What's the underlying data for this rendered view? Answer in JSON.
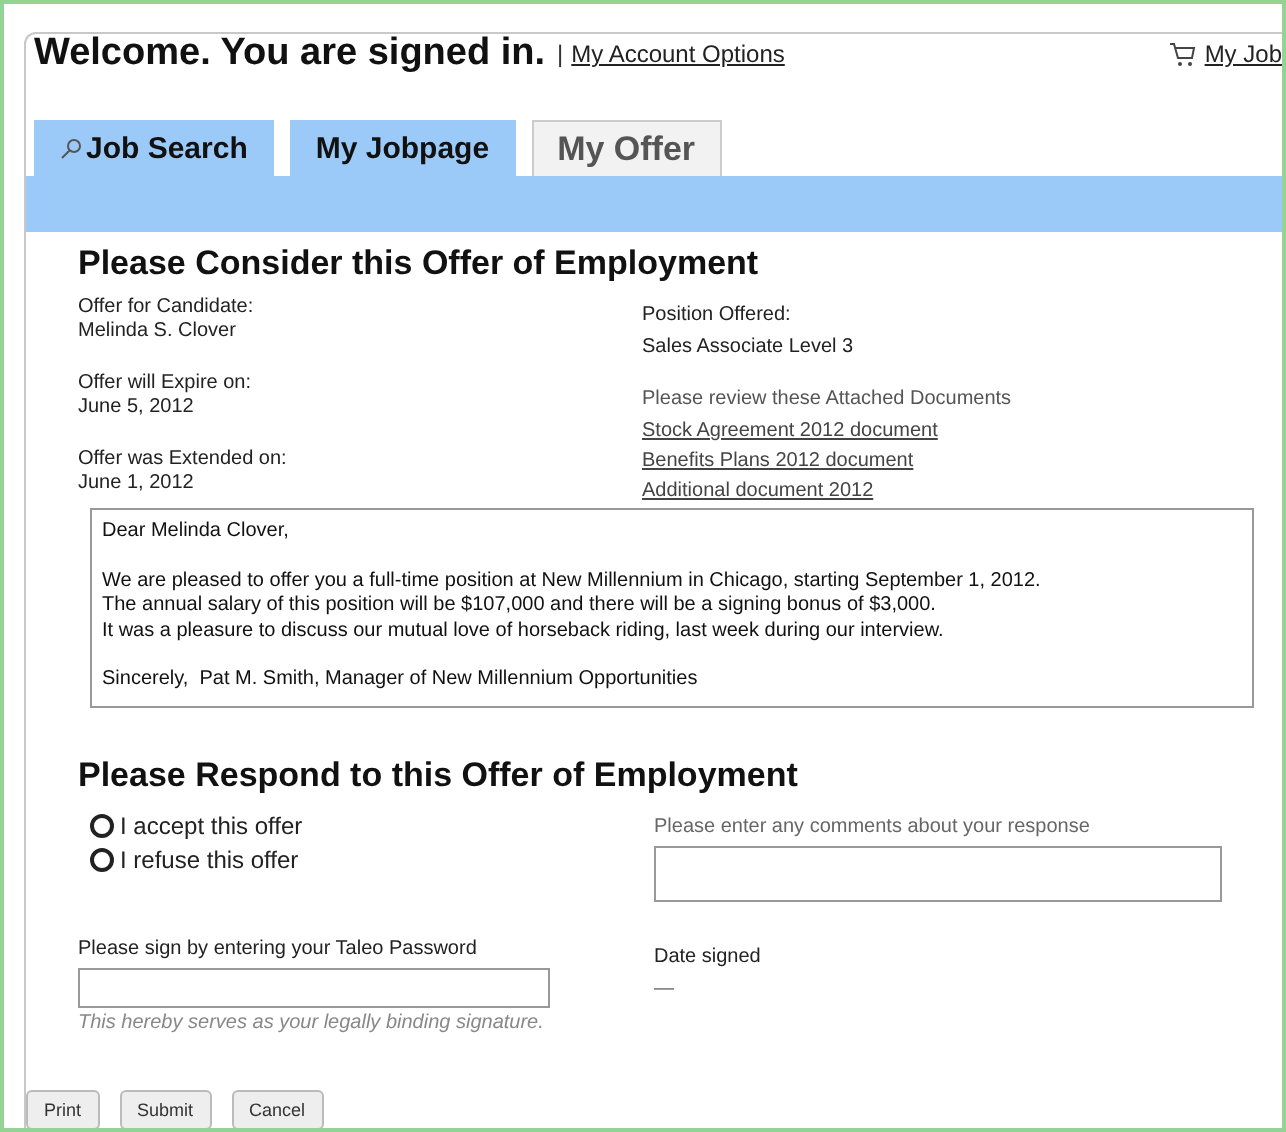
{
  "header": {
    "title": "Welcome. You are signed in.",
    "separator": "|",
    "account_link": "My Account Options",
    "cart_link": "My Job"
  },
  "tabs": [
    {
      "label": "Job Search",
      "selected": false
    },
    {
      "label": "My Jobpage",
      "selected": false
    },
    {
      "label": "My Offer",
      "selected": true
    }
  ],
  "offer": {
    "heading": "Please Consider this Offer of Employment",
    "left": [
      {
        "label": "Offer for Candidate:",
        "value": "Melinda S. Clover"
      },
      {
        "label": "Offer will Expire on:",
        "value": "June 5, 2012"
      },
      {
        "label": "Offer was Extended on:",
        "value": "June 1, 2012"
      }
    ],
    "position": {
      "label": "Position Offered:",
      "value": "Sales Associate Level 3"
    },
    "documents_label": "Please review these Attached Documents",
    "documents": [
      "Stock Agreement 2012 document",
      "Benefits Plans 2012 document",
      "Additional document 2012"
    ]
  },
  "letter": {
    "greeting": "Dear Melinda Clover,",
    "lines": [
      "We are pleased to offer you a full-time position at New Millennium in Chicago, starting September 1, 2012.",
      "The annual salary of this position will be $107,000 and there will be a signing bonus of $3,000.",
      "It was a pleasure to discuss our mutual love of horseback riding, last week during our interview."
    ],
    "closing": "Sincerely,  Pat M. Smith, Manager of New Millennium Opportunities"
  },
  "response": {
    "heading": "Please Respond to this Offer of Employment",
    "options": [
      {
        "label": "I accept this offer",
        "selected": false
      },
      {
        "label": "I refuse this offer",
        "selected": false
      }
    ],
    "comments_label": "Please enter any comments about your response",
    "password_label": "Please sign by entering your Taleo Password",
    "password_hint": "This hereby serves as your legally binding signature.",
    "date_label": "Date signed",
    "date_value": "—"
  },
  "buttons": [
    "Print",
    "Submit",
    "Cancel"
  ]
}
